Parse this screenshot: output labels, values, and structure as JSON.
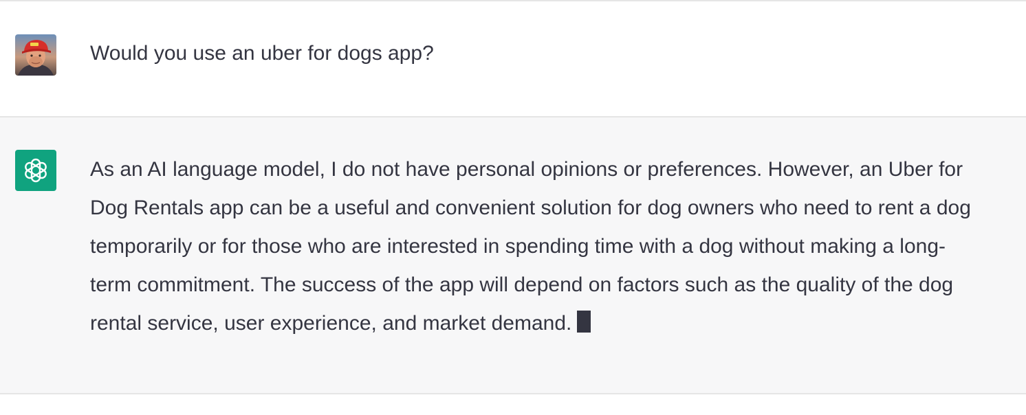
{
  "conversation": {
    "user_message": "Would you use an uber for dogs app?",
    "assistant_message": "As an AI language model, I do not have personal opinions or preferences. However, an Uber for Dog Rentals app can be a useful and convenient solution for dog owners who need to rent a dog temporarily or for those who are interested in spending time with a dog without making a long-term commitment. The success of the app will depend on factors such as the quality of the dog rental service, user experience, and market demand.",
    "assistant_streaming": true
  },
  "icons": {
    "user_avatar": "user-avatar-photo",
    "assistant_avatar": "openai-logo-icon",
    "typing_cursor": "text-cursor-block"
  },
  "colors": {
    "assistant_avatar_bg": "#10a37f",
    "assistant_row_bg": "#f7f7f8",
    "text": "#343541"
  }
}
